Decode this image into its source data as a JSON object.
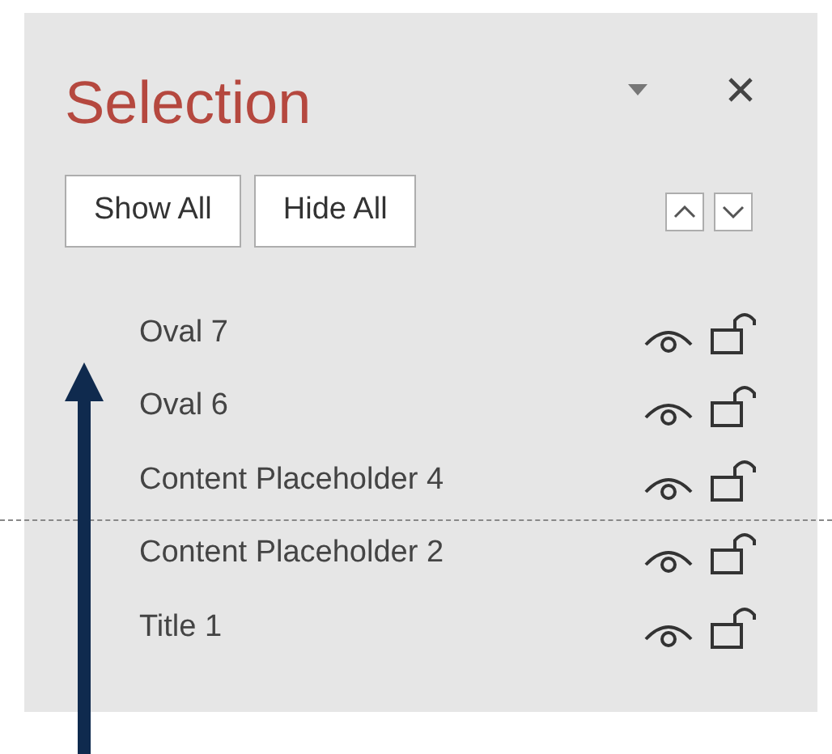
{
  "pane": {
    "title": "Selection"
  },
  "buttons": [
    {
      "label": "Show All"
    },
    {
      "label": "Hide All"
    }
  ],
  "items": [
    {
      "name": "Oval 7",
      "visible": true,
      "locked": false
    },
    {
      "name": "Oval 6",
      "visible": true,
      "locked": false
    },
    {
      "name": "Content Placeholder 4",
      "visible": true,
      "locked": false
    },
    {
      "name": "Content Placeholder 2",
      "visible": true,
      "locked": false
    },
    {
      "name": "Title 1",
      "visible": true,
      "locked": false
    }
  ]
}
